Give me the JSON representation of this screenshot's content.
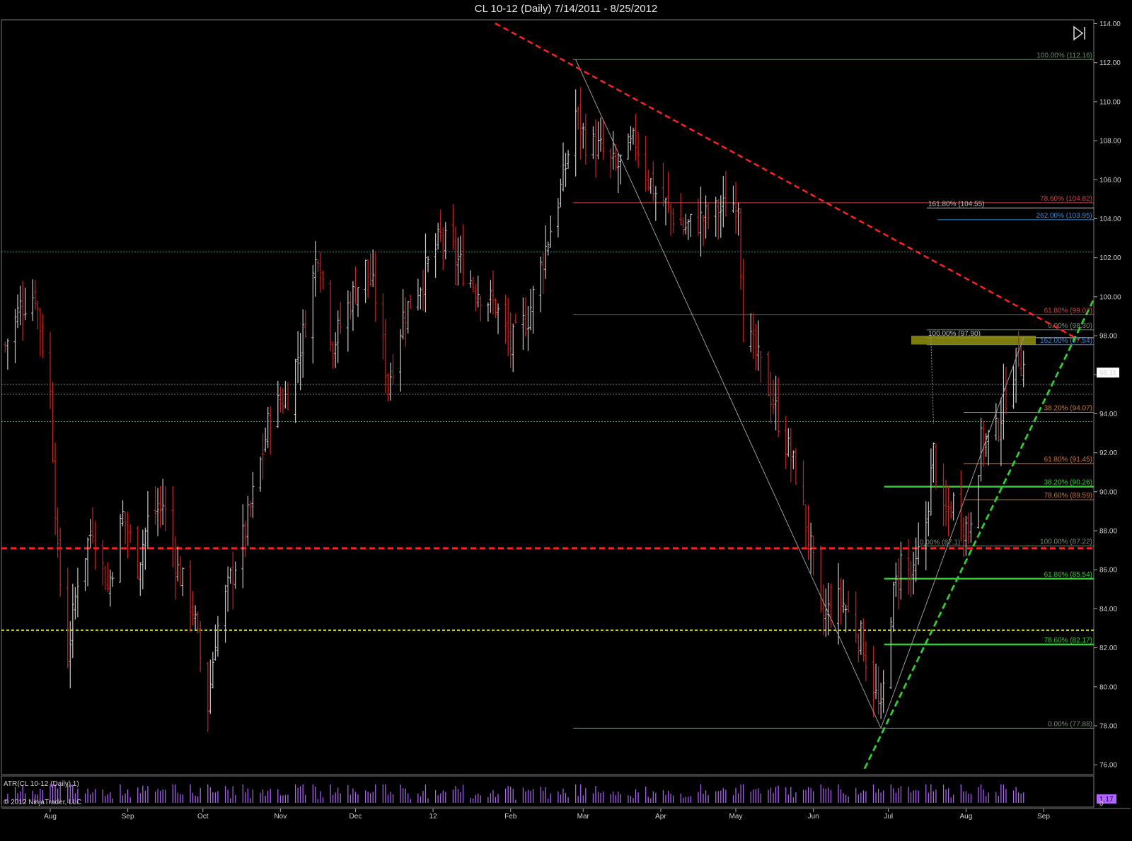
{
  "chart_title": "CL 10-12 (Daily)  7/14/2011 - 8/25/2012",
  "colors": {
    "background": "#000000",
    "up_bar": "#c8c8c8",
    "down_bar": "#cc2222",
    "resistance_red": "#ff2222",
    "trend_green": "#33cc33",
    "support_yellow": "#eeee00",
    "atr_purple": "#b266ff",
    "gold_zone": "#8a8a10"
  },
  "chart_data": {
    "type": "ohlc",
    "title": "CL 10-12 (Daily)  7/14/2011 - 8/25/2012",
    "ylim": [
      75.5,
      114.2
    ],
    "y_ticks": [
      "114.00",
      "112.00",
      "110.00",
      "108.00",
      "106.00",
      "104.00",
      "102.00",
      "100.00",
      "98.00",
      "96.00",
      "94.00",
      "92.00",
      "90.00",
      "88.00",
      "86.00",
      "84.00",
      "82.00",
      "80.00",
      "78.00",
      "76.00"
    ],
    "x_labels": [
      "Aug",
      "Sep",
      "Oct",
      "Nov",
      "Dec",
      "12",
      "Feb",
      "Mar",
      "Apr",
      "May",
      "Jun",
      "Jul",
      "Aug",
      "Sep"
    ],
    "last_price": "96.11",
    "close_path": [
      [
        "2011-07-14",
        97.5
      ],
      [
        "2011-07-20",
        99.5
      ],
      [
        "2011-07-26",
        100.2
      ],
      [
        "2011-08-01",
        95.0
      ],
      [
        "2011-08-04",
        86.6
      ],
      [
        "2011-08-08",
        81.5
      ],
      [
        "2011-08-12",
        85.6
      ],
      [
        "2011-08-18",
        88.3
      ],
      [
        "2011-08-24",
        85.0
      ],
      [
        "2011-08-30",
        88.8
      ],
      [
        "2011-09-05",
        86.3
      ],
      [
        "2011-09-09",
        88.5
      ],
      [
        "2011-09-15",
        89.4
      ],
      [
        "2011-09-21",
        86.0
      ],
      [
        "2011-09-27",
        84.0
      ],
      [
        "2011-10-03",
        79.0
      ],
      [
        "2011-10-06",
        82.6
      ],
      [
        "2011-10-12",
        85.5
      ],
      [
        "2011-10-18",
        88.0
      ],
      [
        "2011-10-24",
        91.5
      ],
      [
        "2011-10-28",
        94.0
      ],
      [
        "2011-11-04",
        95.0
      ],
      [
        "2011-11-10",
        98.0
      ],
      [
        "2011-11-16",
        102.5
      ],
      [
        "2011-11-22",
        97.5
      ],
      [
        "2011-11-28",
        99.5
      ],
      [
        "2011-12-05",
        101.5
      ],
      [
        "2011-12-09",
        100.0
      ],
      [
        "2011-12-14",
        95.5
      ],
      [
        "2011-12-20",
        99.0
      ],
      [
        "2011-12-28",
        101.0
      ],
      [
        "2012-01-04",
        103.0
      ],
      [
        "2012-01-10",
        102.0
      ],
      [
        "2012-01-18",
        100.5
      ],
      [
        "2012-01-26",
        99.5
      ],
      [
        "2012-02-01",
        97.5
      ],
      [
        "2012-02-08",
        99.0
      ],
      [
        "2012-02-16",
        103.0
      ],
      [
        "2012-02-22",
        106.0
      ],
      [
        "2012-02-27",
        109.5
      ],
      [
        "2012-03-02",
        108.0
      ],
      [
        "2012-03-08",
        107.5
      ],
      [
        "2012-03-14",
        106.5
      ],
      [
        "2012-03-22",
        108.0
      ],
      [
        "2012-03-29",
        105.5
      ],
      [
        "2012-04-04",
        104.5
      ],
      [
        "2012-04-10",
        103.5
      ],
      [
        "2012-04-18",
        104.0
      ],
      [
        "2012-04-26",
        104.5
      ],
      [
        "2012-05-02",
        105.0
      ],
      [
        "2012-05-04",
        98.5
      ],
      [
        "2012-05-09",
        97.0
      ],
      [
        "2012-05-15",
        95.0
      ],
      [
        "2012-05-21",
        92.5
      ],
      [
        "2012-05-25",
        91.0
      ],
      [
        "2012-05-31",
        87.0
      ],
      [
        "2012-06-04",
        83.5
      ],
      [
        "2012-06-12",
        84.5
      ],
      [
        "2012-06-20",
        82.5
      ],
      [
        "2012-06-25",
        80.0
      ],
      [
        "2012-06-28",
        78.5
      ],
      [
        "2012-07-02",
        84.0
      ],
      [
        "2012-07-06",
        86.5
      ],
      [
        "2012-07-11",
        85.5
      ],
      [
        "2012-07-16",
        88.5
      ],
      [
        "2012-07-19",
        92.0
      ],
      [
        "2012-07-23",
        88.5
      ],
      [
        "2012-07-27",
        89.5
      ],
      [
        "2012-08-02",
        88.0
      ],
      [
        "2012-08-07",
        92.5
      ],
      [
        "2012-08-13",
        93.0
      ],
      [
        "2012-08-17",
        95.0
      ],
      [
        "2012-08-22",
        97.0
      ],
      [
        "2012-08-25",
        96.11
      ]
    ],
    "horizontal_lines": [
      {
        "price": 112.16,
        "label": "100.00% (112.16)",
        "color": "#6a8a6a",
        "style": "solid"
      },
      {
        "price": 104.82,
        "label": "78.60% (104.82)",
        "color": "#cc4444",
        "style": "solid"
      },
      {
        "price": 104.55,
        "label": "161.80% (104.55)",
        "color": "#bbbbbb",
        "style": "solid"
      },
      {
        "price": 103.95,
        "label": "262.00% (103.95)",
        "color": "#3a8ad8",
        "style": "solid"
      },
      {
        "price": 102.3,
        "label": "",
        "color": "#5a8a8a",
        "style": "dotted"
      },
      {
        "price": 99.07,
        "label": "61.80% (99.07)",
        "color": "#cc4444",
        "style": "solid"
      },
      {
        "price": 98.3,
        "label": "0.00% (98.30)",
        "color": "#778877",
        "style": "solid"
      },
      {
        "price": 97.9,
        "label": "100.00% (97.90)",
        "color": "#bbbbbb",
        "style": "solid"
      },
      {
        "price": 97.54,
        "label": "162.00% (97.54)",
        "color": "#3a8ad8",
        "style": "solid"
      },
      {
        "price": 95.5,
        "label": "",
        "color": "#5a8a8a",
        "style": "dotted"
      },
      {
        "price": 95.0,
        "label": "",
        "color": "#5a8a8a",
        "style": "dotted"
      },
      {
        "price": 94.07,
        "label": "38.20% (94.07)",
        "color": "#cc7733",
        "style": "solid"
      },
      {
        "price": 93.6,
        "label": "",
        "color": "#5a8a8a",
        "style": "dotted"
      },
      {
        "price": 91.45,
        "label": "61.80% (91.45)",
        "color": "#cc7733",
        "style": "solid"
      },
      {
        "price": 90.26,
        "label": "38.20% (90.26)",
        "color": "#33cc33",
        "style": "thick"
      },
      {
        "price": 89.59,
        "label": "78.60% (89.59)",
        "color": "#cc7733",
        "style": "solid"
      },
      {
        "price": 87.22,
        "label": "100.00% (87.22)",
        "color": "#778877",
        "style": "solid"
      },
      {
        "price": 87.1,
        "label": "",
        "color": "#ff2222",
        "style": "thickdash"
      },
      {
        "price": 85.54,
        "label": "61.80% (85.54)",
        "color": "#33cc33",
        "style": "thick"
      },
      {
        "price": 82.9,
        "label": "",
        "color": "#eeee00",
        "style": "yellowdash"
      },
      {
        "price": 82.17,
        "label": "78.60% (82.17)",
        "color": "#33cc33",
        "style": "thick"
      },
      {
        "price": 77.88,
        "label": "0.00% (77.88)",
        "color": "#778877",
        "style": "solid"
      }
    ],
    "extra_labels": [
      "0.00% (87.1)"
    ],
    "atr_label": "ATR(CL 10-12 (Daily),1)",
    "atr_value": "1.17",
    "atr_zero": "0",
    "copyright": "© 2012 NinjaTrader, LLC"
  }
}
